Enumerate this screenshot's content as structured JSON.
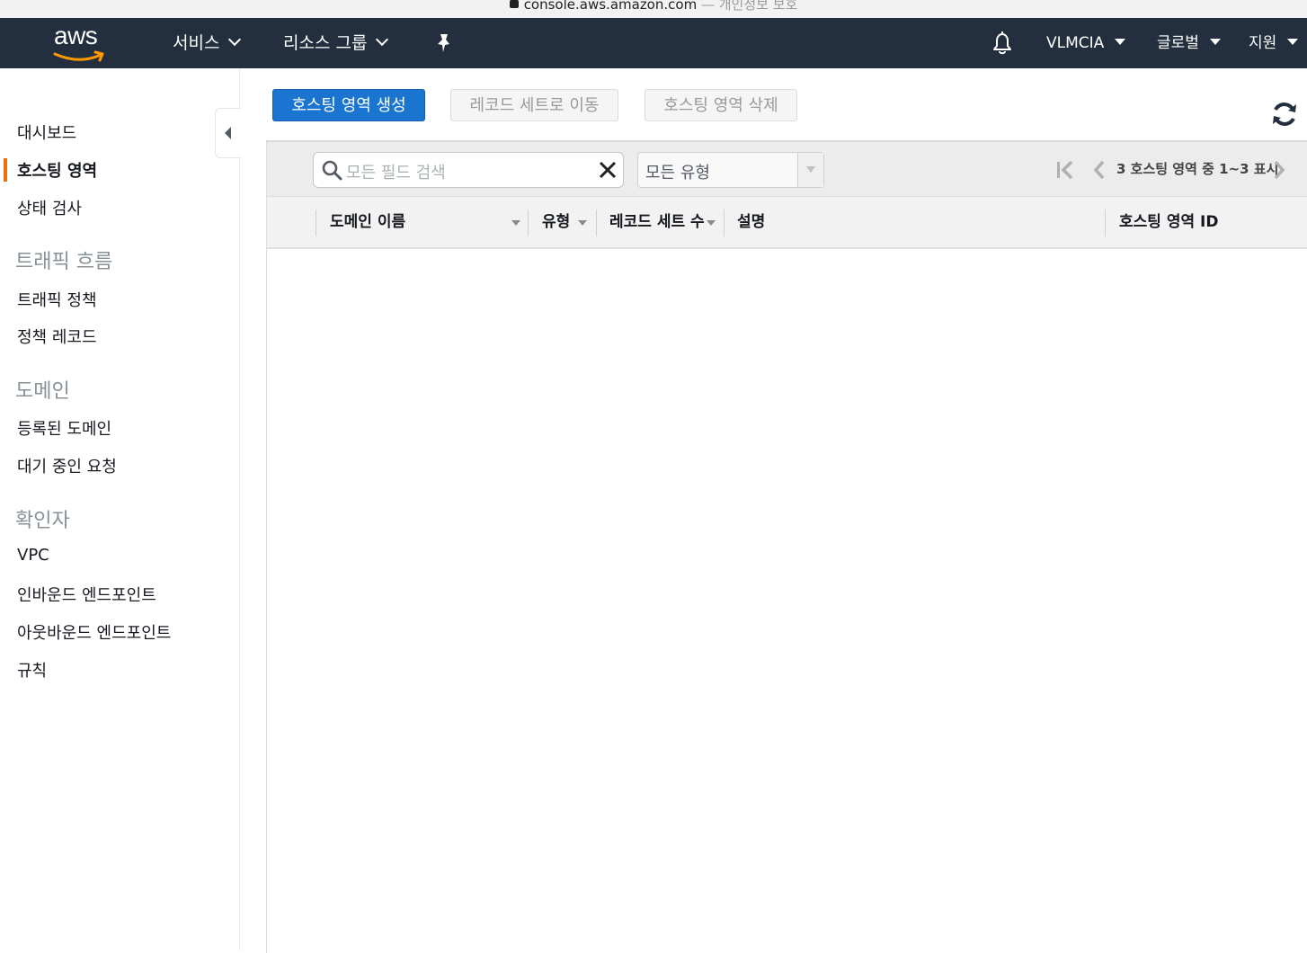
{
  "browser": {
    "url": "console.aws.amazon.com",
    "privacy": "— 개인정보 보호"
  },
  "topnav": {
    "logo": "aws",
    "services": "서비스",
    "resource_groups": "리소스 그룹",
    "pin_icon": "pin-icon",
    "bell_icon": "bell-icon",
    "account": "VLMCIA",
    "region": "글로벌",
    "support": "지원"
  },
  "sidebar": {
    "items": [
      {
        "label": "대시보드"
      },
      {
        "label": "호스팅 영역",
        "active": true
      },
      {
        "label": "상태 검사"
      }
    ],
    "sections": [
      {
        "heading": "트래픽 흐름",
        "items": [
          "트래픽 정책",
          "정책 레코드"
        ]
      },
      {
        "heading": "도메인",
        "items": [
          "등록된 도메인",
          "대기 중인 요청"
        ]
      },
      {
        "heading": "확인자",
        "items": [
          "VPC",
          "인바운드 엔드포인트",
          "아웃바운드 엔드포인트",
          "규칙"
        ]
      }
    ],
    "active_color": "#ec7211"
  },
  "actions": {
    "create": "호스팅 영역 생성",
    "move": "레코드 세트로 이동",
    "delete": "호스팅 영역 삭제",
    "primary_color": "#1a75d0"
  },
  "filter": {
    "search_placeholder": "모든 필드 검색",
    "type_value": "모든 유형"
  },
  "pagination": {
    "text": "3 호스팅 영역 중 1~3 표시"
  },
  "table": {
    "columns": [
      "도메인 이름",
      "유형",
      "레코드 세트 수",
      "설명",
      "호스팅 영역 ID"
    ],
    "rows": []
  }
}
